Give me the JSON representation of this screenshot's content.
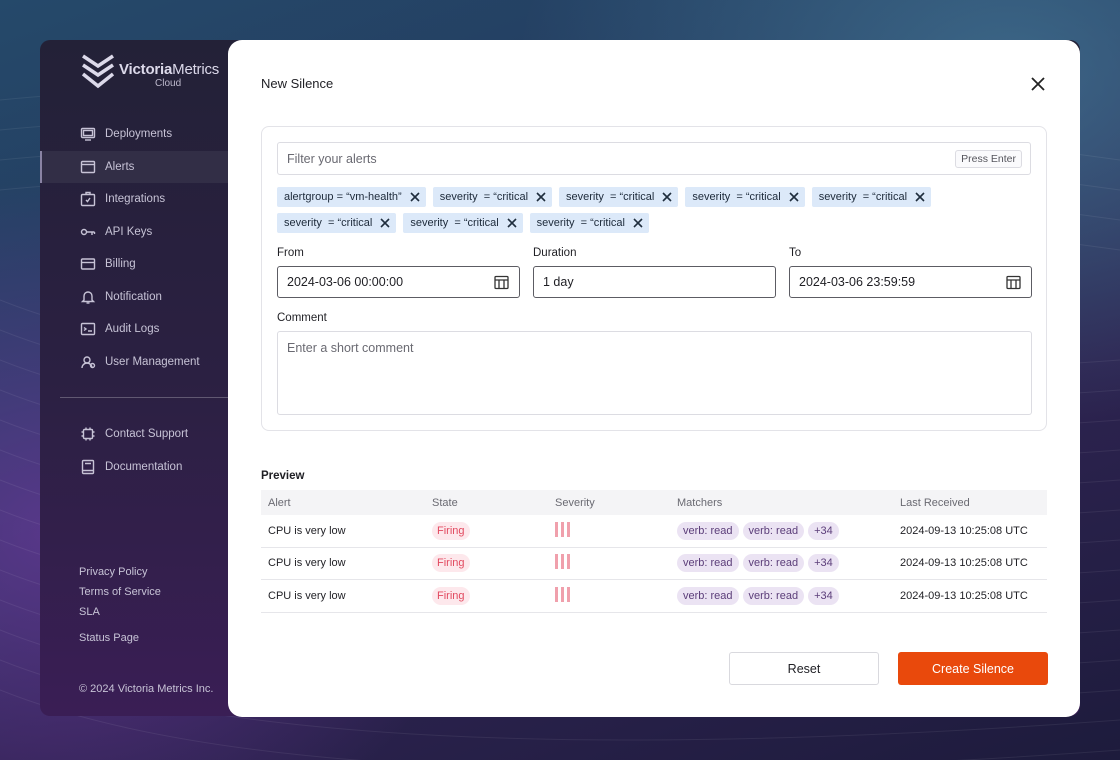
{
  "app": {
    "logo": {
      "brand_bold": "Victoria",
      "brand_light": "Metrics",
      "sub": "Cloud"
    },
    "sidebar": {
      "items": [
        {
          "label": "Deployments",
          "icon": "monitor-icon",
          "active": false
        },
        {
          "label": "Alerts",
          "icon": "window-icon",
          "active": true
        },
        {
          "label": "Integrations",
          "icon": "puzzle-icon",
          "active": false
        },
        {
          "label": "API Keys",
          "icon": "key-icon",
          "active": false
        },
        {
          "label": "Billing",
          "icon": "card-icon",
          "active": false
        },
        {
          "label": "Notification",
          "icon": "bell-icon",
          "active": false
        },
        {
          "label": "Audit Logs",
          "icon": "audit-icon",
          "active": false
        },
        {
          "label": "User Management",
          "icon": "users-icon",
          "active": false
        }
      ],
      "secondary": [
        {
          "label": "Contact Support",
          "icon": "chip-icon"
        },
        {
          "label": "Documentation",
          "icon": "book-icon"
        }
      ],
      "footer_links": [
        "Privacy Policy",
        "Terms of Service",
        "SLA"
      ],
      "status_page": "Status Page",
      "copyright": "© 2024 Victoria Metrics Inc."
    }
  },
  "modal": {
    "title": "New Silence",
    "filter": {
      "placeholder": "Filter your alerts",
      "hint": "Press Enter"
    },
    "chips": [
      "alertgroup = “vm-health”",
      "severity  = “critical",
      "severity  = “critical",
      "severity  = “critical",
      "severity  = “critical",
      "severity  = “critical",
      "severity  = “critical",
      "severity  = “critical"
    ],
    "from": {
      "label": "From",
      "value": "2024-03-06 00:00:00"
    },
    "duration": {
      "label": "Duration",
      "value": "1 day"
    },
    "to": {
      "label": "To",
      "value": "2024-03-06 23:59:59"
    },
    "comment": {
      "label": "Comment",
      "placeholder": "Enter a short comment"
    },
    "preview": {
      "label": "Preview",
      "columns": [
        "Alert",
        "State",
        "Severity",
        "Matchers",
        "Last Received"
      ],
      "rows": [
        {
          "alert": "CPU is very low",
          "state": "Firing",
          "severity_level": 3,
          "matchers": [
            "verb: read",
            "verb: read",
            "+34"
          ],
          "last_received": "2024-09-13 10:25:08 UTC"
        },
        {
          "alert": "CPU is very low",
          "state": "Firing",
          "severity_level": 3,
          "matchers": [
            "verb: read",
            "verb: read",
            "+34"
          ],
          "last_received": "2024-09-13 10:25:08 UTC"
        },
        {
          "alert": "CPU is very low",
          "state": "Firing",
          "severity_level": 3,
          "matchers": [
            "verb: read",
            "verb: read",
            "+34"
          ],
          "last_received": "2024-09-13 10:25:08 UTC"
        }
      ]
    },
    "buttons": {
      "reset": "Reset",
      "create": "Create Silence"
    },
    "colors": {
      "primary": "#e9490c",
      "chip_bg": "#dce9f9",
      "firing": "#e24a60",
      "matcher": "#5b3d79"
    }
  }
}
